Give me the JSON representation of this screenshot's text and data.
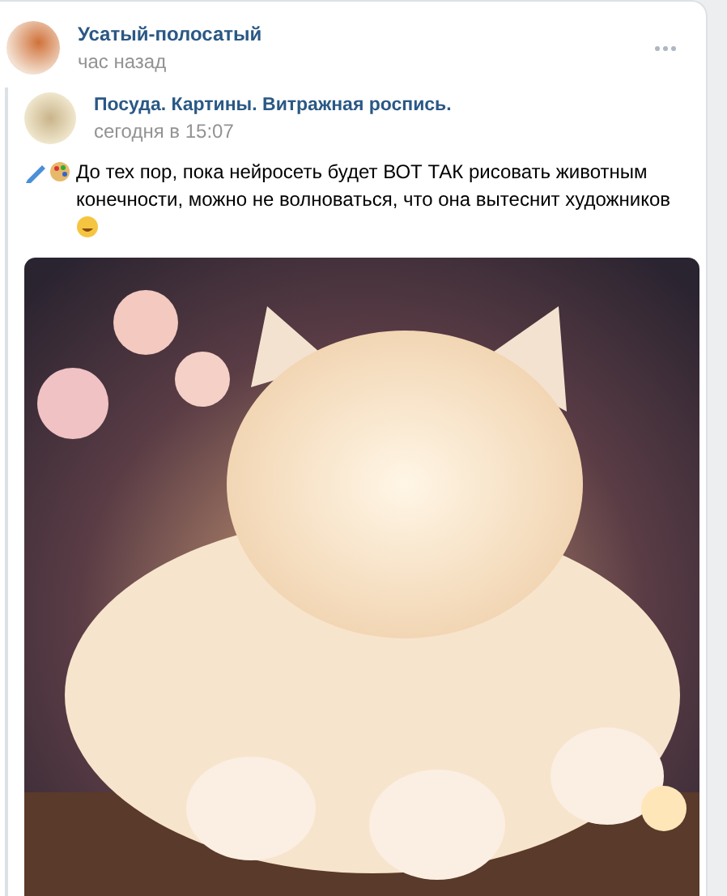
{
  "post": {
    "author": "Усатый-полосатый",
    "time": "час назад",
    "repost": {
      "author": "Посуда. Картины. Витражная роспись.",
      "time": "сегодня в 15:07",
      "text": "До тех пор, пока нейросеть будет ВОТ ТАК рисовать животным конечности, можно не волноваться, что она вытеснит художников"
    }
  }
}
